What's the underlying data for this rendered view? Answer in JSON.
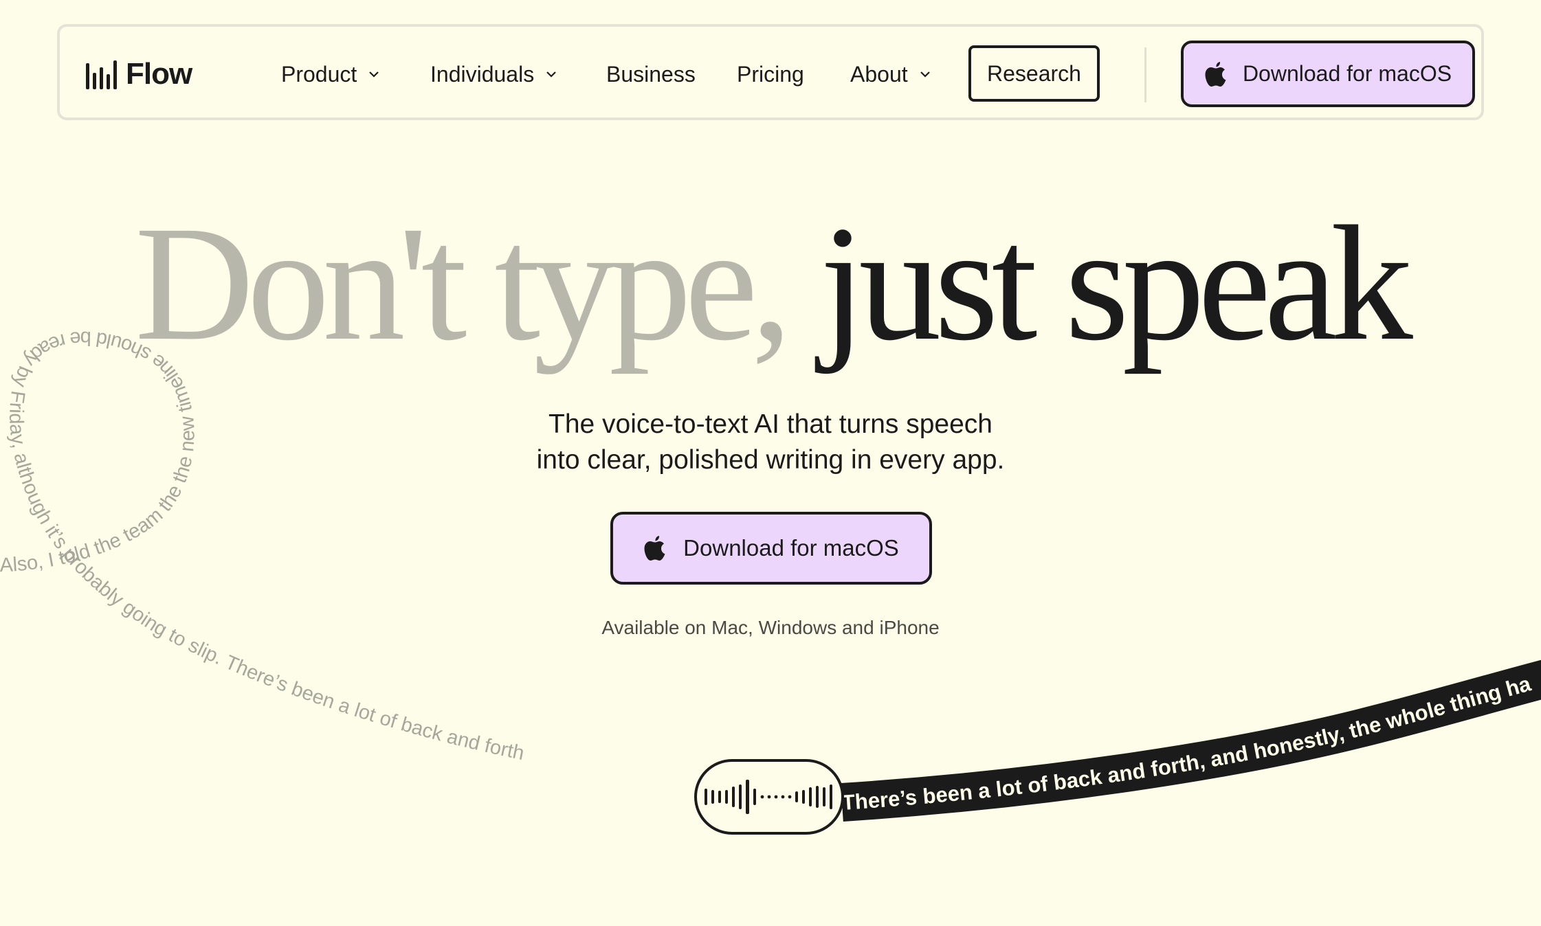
{
  "brand": {
    "name": "Flow"
  },
  "nav": {
    "items": [
      {
        "label": "Product",
        "has_dropdown": true
      },
      {
        "label": "Individuals",
        "has_dropdown": true
      },
      {
        "label": "Business",
        "has_dropdown": false
      },
      {
        "label": "Pricing",
        "has_dropdown": false
      },
      {
        "label": "About",
        "has_dropdown": true
      }
    ],
    "research_label": "Research",
    "download_label": "Download for macOS"
  },
  "hero": {
    "headline_light": "Don't type,",
    "headline_dark": "just speak",
    "subtitle_line1": "The voice-to-text AI that turns speech",
    "subtitle_line2": "into clear, polished writing in every app.",
    "cta_label": "Download for macOS",
    "availability": "Available on Mac, Windows and iPhone"
  },
  "demo": {
    "loop_text": "Also, I told the team the the new timeline should be ready by Friday, although it’s probably going to slip. There’s been a lot of back and forth",
    "ribbon_text": "There’s been a lot of back and forth, and honestly, the whole thing ha"
  },
  "colors": {
    "background": "#fefde9",
    "accent_button": "#ecd6fc",
    "text_dark": "#1b1b1b",
    "headline_grey": "#b7b8ab",
    "ribbon": "#1b1b1b"
  },
  "icons": [
    "apple-icon",
    "chevron-down-icon",
    "flow-logo-icon",
    "waveform-icon"
  ]
}
